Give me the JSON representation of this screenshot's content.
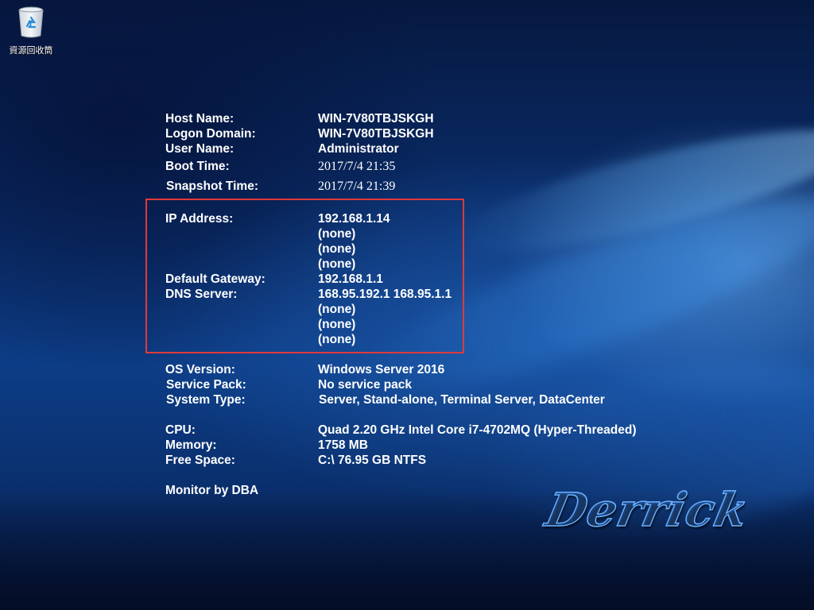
{
  "desktop": {
    "icons": [
      {
        "label": "資源回收筒",
        "icon": "recycle-bin-icon"
      }
    ]
  },
  "info": {
    "host_name": {
      "label": "Host Name:",
      "value": "WIN-7V80TBJSKGH"
    },
    "logon_domain": {
      "label": "Logon Domain:",
      "value": "WIN-7V80TBJSKGH"
    },
    "user_name": {
      "label": "User Name:",
      "value": "Administrator"
    },
    "boot_time": {
      "label": "Boot Time:",
      "value": "2017/7/4 21:35"
    },
    "snapshot_time": {
      "label": "Snapshot Time:",
      "value": "2017/7/4 21:39"
    },
    "ip_address": {
      "label": "IP Address:",
      "values": [
        "192.168.1.14",
        "(none)",
        "(none)",
        "(none)"
      ]
    },
    "default_gateway": {
      "label": "Default Gateway:",
      "value": "192.168.1.1"
    },
    "dns_server": {
      "label": "DNS Server:",
      "values": [
        "168.95.192.1 168.95.1.1",
        "(none)",
        "(none)",
        "(none)"
      ]
    },
    "os_version": {
      "label": "OS Version:",
      "value": "Windows Server 2016"
    },
    "service_pack": {
      "label": "Service Pack:",
      "value": "No service pack"
    },
    "system_type": {
      "label": "System Type:",
      "value": "Server, Stand-alone, Terminal Server, DataCenter"
    },
    "cpu": {
      "label": "CPU:",
      "value": "Quad 2.20 GHz Intel Core i7-4702MQ (Hyper-Threaded)"
    },
    "memory": {
      "label": "Memory:",
      "value": "1758 MB"
    },
    "free_space": {
      "label": "Free Space:",
      "value": "C:\\ 76.95 GB NTFS"
    },
    "footer": "Monitor by DBA"
  },
  "logo": {
    "text": "Derrick"
  },
  "colors": {
    "highlight_border": "#e0393b",
    "text": "#ffffff"
  }
}
